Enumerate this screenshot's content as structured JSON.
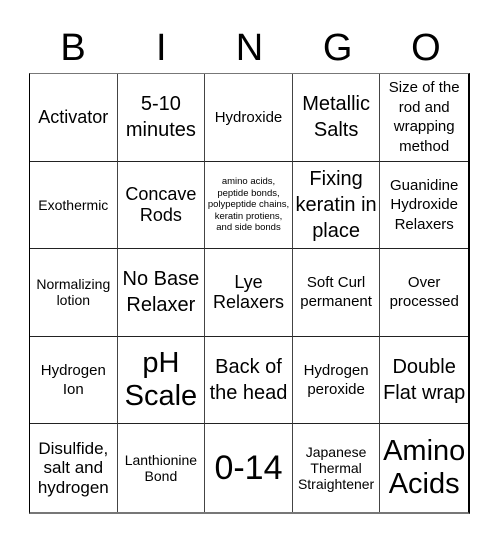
{
  "header": {
    "letters": [
      "B",
      "I",
      "N",
      "G",
      "O"
    ]
  },
  "cells": [
    {
      "text": "Activator",
      "size": "s18"
    },
    {
      "text": "5-10 minutes",
      "size": "s20"
    },
    {
      "text": "Hydroxide",
      "size": "s15"
    },
    {
      "text": "Metallic Salts",
      "size": "s20"
    },
    {
      "text": "Size of the rod and wrapping method",
      "size": "s15"
    },
    {
      "text": "Exothermic",
      "size": "s14"
    },
    {
      "text": "Concave Rods",
      "size": "s18"
    },
    {
      "text": "amino acids, peptide bonds, polypeptide chains, keratin protiens, and side bonds",
      "size": "s9"
    },
    {
      "text": "Fixing keratin in place",
      "size": "s20"
    },
    {
      "text": "Guanidine Hydroxide Relaxers",
      "size": "s15"
    },
    {
      "text": "Normalizing lotion",
      "size": "s14"
    },
    {
      "text": "No Base Relaxer",
      "size": "s20"
    },
    {
      "text": "Lye Relaxers",
      "size": "s18"
    },
    {
      "text": "Soft Curl permanent",
      "size": "s15"
    },
    {
      "text": "Over processed",
      "size": "s15"
    },
    {
      "text": "Hydrogen Ion",
      "size": "s15"
    },
    {
      "text": "pH Scale",
      "size": "s29"
    },
    {
      "text": "Back of the head",
      "size": "s20"
    },
    {
      "text": "Hydrogen peroxide",
      "size": "s15"
    },
    {
      "text": "Double Flat wrap",
      "size": "s20"
    },
    {
      "text": "Disulfide, salt and hydrogen",
      "size": "s17"
    },
    {
      "text": "Lanthionine Bond",
      "size": "s14"
    },
    {
      "text": "0-14",
      "size": "s34"
    },
    {
      "text": "Japanese Thermal Straightener",
      "size": "s14"
    },
    {
      "text": "Amino Acids",
      "size": "s29"
    }
  ]
}
